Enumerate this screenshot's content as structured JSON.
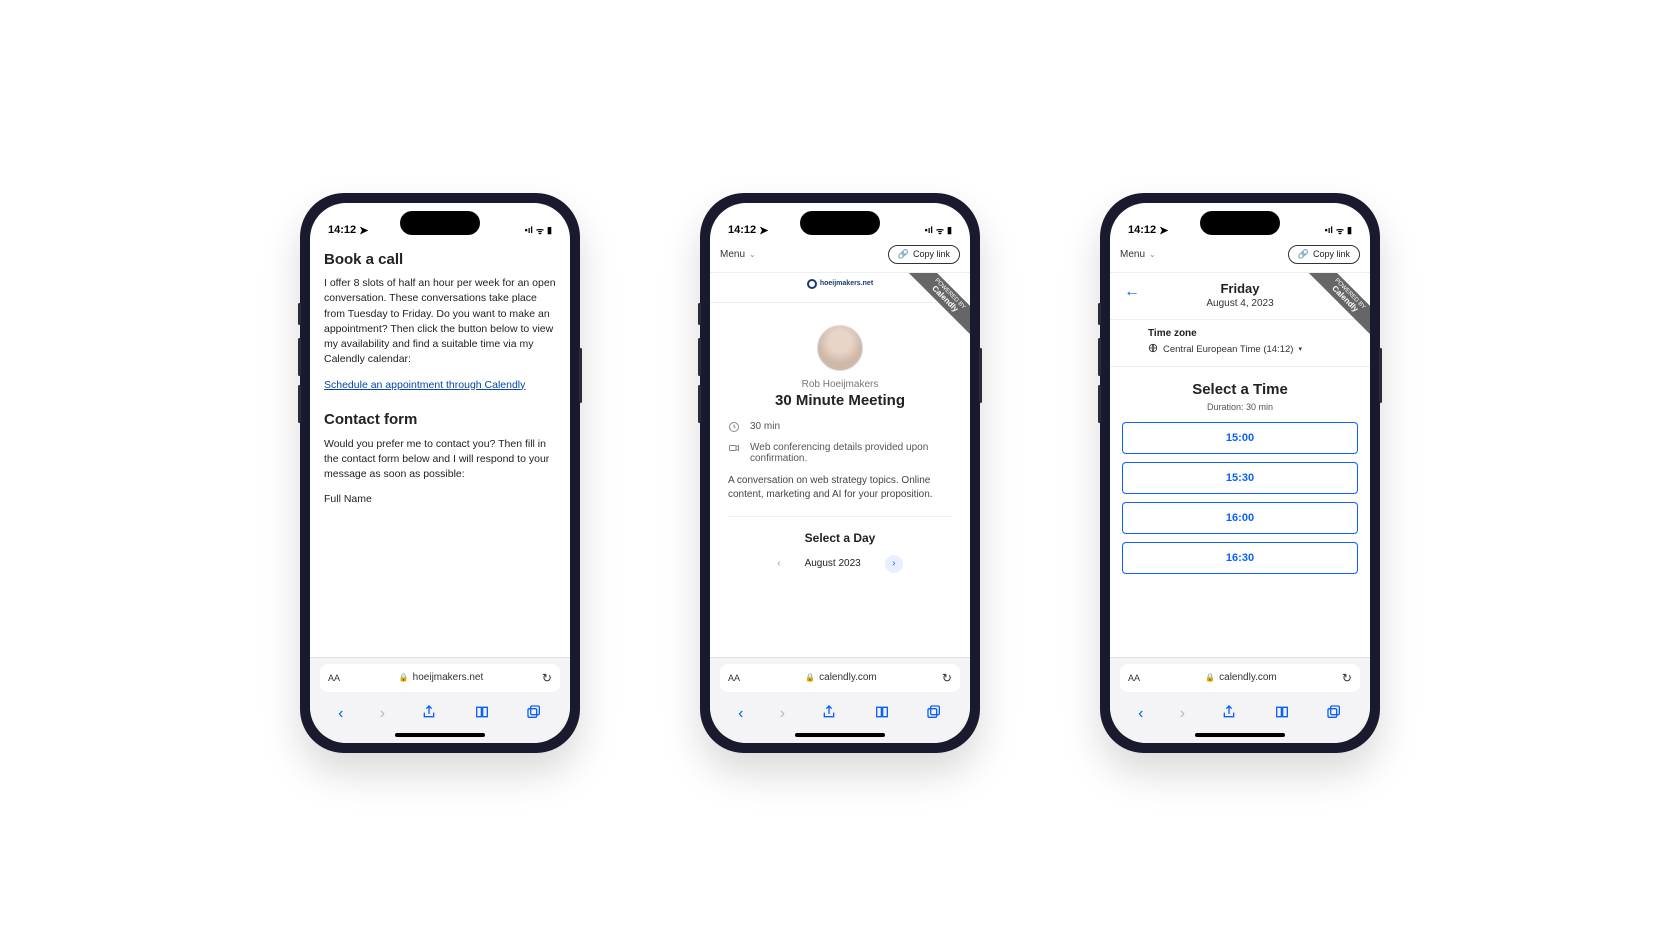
{
  "status": {
    "time": "14:12",
    "location_icon": "➤",
    "signal": "•ıl",
    "wifi": "ᯤ",
    "battery": "▮"
  },
  "browser": {
    "aa": "AA",
    "lock": "🔒",
    "reload": "↻",
    "nav": {
      "back": "‹",
      "forward": "›",
      "share": "⇧",
      "bookmarks": "▭▭",
      "tabs": "⧉"
    }
  },
  "phone1": {
    "url": "hoeijmakers.net",
    "heading1": "Book a call",
    "para1": "I offer 8 slots of half an hour per week for an open conversation. These conversations take place from Tuesday to Friday. Do you want to make an appointment? Then click the button below to view my availability and find a suitable time via my Calendly calendar:",
    "link": "Schedule an appointment through Calendly",
    "heading2": "Contact form",
    "para2": "Would you prefer me to contact you? Then fill in the contact form below and I will respond to your message as soon as possible:",
    "field_label": "Full Name"
  },
  "phone2": {
    "url": "calendly.com",
    "menu": "Menu",
    "copy": "Copy link",
    "ribbon_small": "POWERED BY",
    "ribbon_big": "Calendly",
    "logo_text": "hoeijmakers.net",
    "host": "Rob Hoeijmakers",
    "title": "30 Minute Meeting",
    "duration": "30 min",
    "conf": "Web conferencing details provided upon confirmation.",
    "desc": "A conversation on web strategy topics. Online content, marketing and AI for your proposition.",
    "select_day": "Select a Day",
    "month": "August 2023"
  },
  "phone3": {
    "url": "calendly.com",
    "menu": "Menu",
    "copy": "Copy link",
    "ribbon_small": "POWERED BY",
    "ribbon_big": "Calendly",
    "day": "Friday",
    "date": "August 4, 2023",
    "tz_label": "Time zone",
    "tz_value": "Central European Time (14:12)",
    "select_time": "Select a Time",
    "duration": "Duration: 30 min",
    "slots": [
      "15:00",
      "15:30",
      "16:00",
      "16:30"
    ]
  }
}
